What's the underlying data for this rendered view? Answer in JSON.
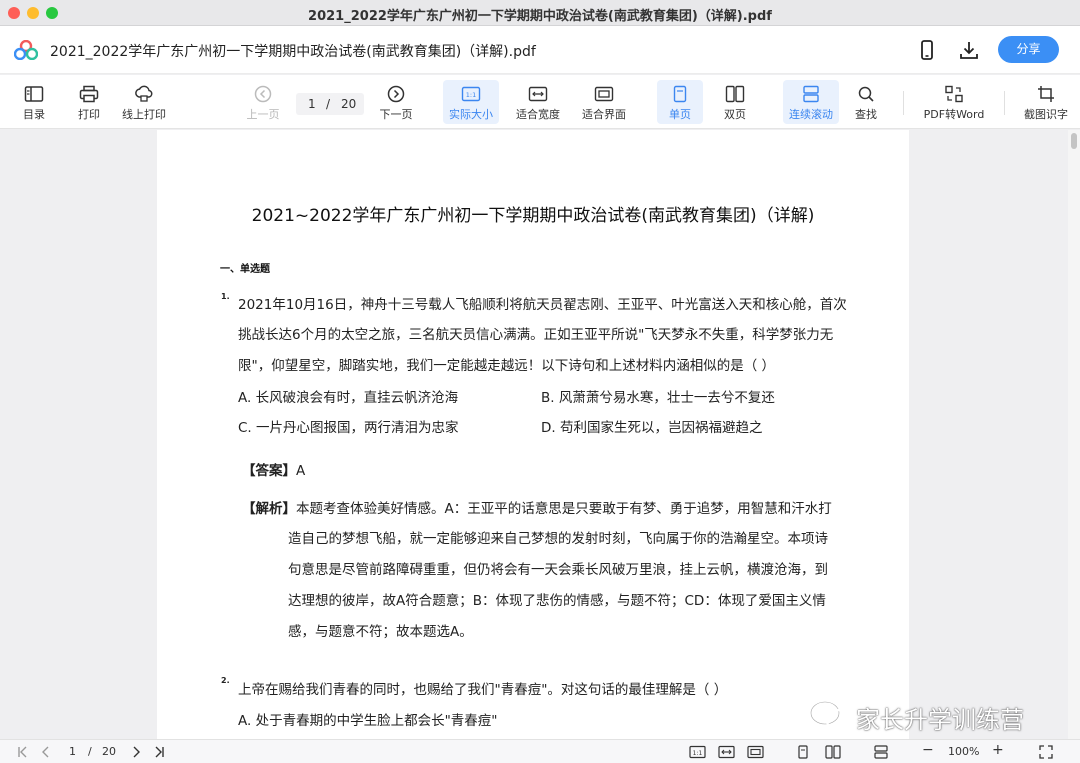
{
  "window": {
    "title": "2021_2022学年广东广州初一下学期期中政治试卷(南武教育集团)（详解).pdf"
  },
  "header": {
    "doc_name": "2021_2022学年广东广州初一下学期期中政治试卷(南武教育集团)（详解).pdf",
    "share_label": "分享",
    "icons": [
      "app-logo-icon",
      "phone-icon",
      "download-icon"
    ]
  },
  "toolbar": {
    "toc": "目录",
    "print": "打印",
    "online_print": "线上打印",
    "prev_page": "上一页",
    "page_current": "1",
    "page_sep": "/",
    "page_total": "20",
    "next_page": "下一页",
    "actual_size": "实际大小",
    "fit_width": "适合宽度",
    "fit_page": "适合界面",
    "single_page": "单页",
    "double_page": "双页",
    "continuous_scroll": "连续滚动",
    "find": "查找",
    "pdf_to_word": "PDF转Word",
    "ocr": "截图识字",
    "accent_color": "#3b86f0"
  },
  "document": {
    "title": "2021~2022学年广东广州初一下学期期中政治试卷(南武教育集团)（详解)",
    "section": "一、单选题",
    "q1": {
      "num": "1.",
      "lines": [
        "2021年10月16日，神舟十三号载人飞船顺利将航天员翟志刚、王亚平、叶光富送入天和核心舱，首次",
        "挑战长达6个月的太空之旅，三名航天员信心满满。正如王亚平所说\"飞天梦永不失重，科学梦张力无",
        "限\"，仰望星空，脚踏实地，我们一定能越走越远！以下诗句和上述材料内涵相似的是（     ）"
      ],
      "option_a": "A. 长风破浪会有时，直挂云帆济沧海",
      "option_b": "B. 风萧萧兮易水寒，壮士一去兮不复还",
      "option_c": "C. 一片丹心图报国，两行清泪为忠家",
      "option_d": "D. 苟利国家生死以，岂因祸福避趋之",
      "answer_label": "【答案】",
      "answer_value": "A",
      "analysis_label": "【解析】",
      "analysis_lines": [
        "本题考查体验美好情感。A：王亚平的话意思是只要敢于有梦、勇于追梦，用智慧和汗水打",
        "造自己的梦想飞船，就一定能够迎来自己梦想的发射时刻，飞向属于你的浩瀚星空。本项诗",
        "句意思是尽管前路障碍重重，但仍将会有一天会乘长风破万里浪，挂上云帆，横渡沧海，到",
        "达理想的彼岸，故A符合题意；B：体现了悲伤的情感，与题不符；CD：体现了爱国主义情",
        "感，与题意不符；故本题选A。"
      ]
    },
    "q2": {
      "num": "2.",
      "line": "上帝在赐给我们青春的同时，也赐给了我们\"青春痘\"。对这句话的最佳理解是（        ）",
      "option_a": "A. 处于青春期的中学生脸上都会长\"青春痘\""
    }
  },
  "watermark": {
    "text": "家长升学训练营"
  },
  "statusbar": {
    "page_current": "1",
    "page_sep": "/",
    "page_total": "20",
    "zoom_out": "−",
    "zoom": "100%",
    "zoom_in": "+"
  }
}
